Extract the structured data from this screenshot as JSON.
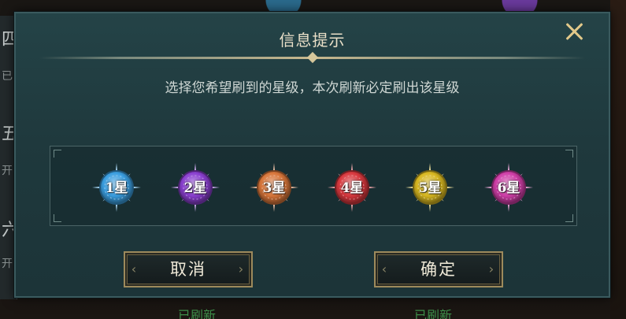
{
  "dialog": {
    "title": "信息提示",
    "subtitle": "选择您希望刷到的星级，本次刷新必定刷出该星级",
    "cancel_label": "取消",
    "confirm_label": "确定"
  },
  "star_options": [
    {
      "label": "1星",
      "color": "#3a9ee0"
    },
    {
      "label": "2星",
      "color": "#8a3fd0"
    },
    {
      "label": "3星",
      "color": "#d8763a"
    },
    {
      "label": "4星",
      "color": "#d8383e"
    },
    {
      "label": "5星",
      "color": "#d8b820"
    },
    {
      "label": "6星",
      "color": "#d03ea8"
    }
  ],
  "background": {
    "left_chars": [
      "四",
      "五",
      "六"
    ],
    "left_subs": [
      "已",
      "开",
      "开"
    ],
    "bottom_text": [
      "已刷新",
      "已刷新"
    ]
  },
  "colors": {
    "accent_gold": "#e2c98a",
    "panel": "#244347"
  }
}
